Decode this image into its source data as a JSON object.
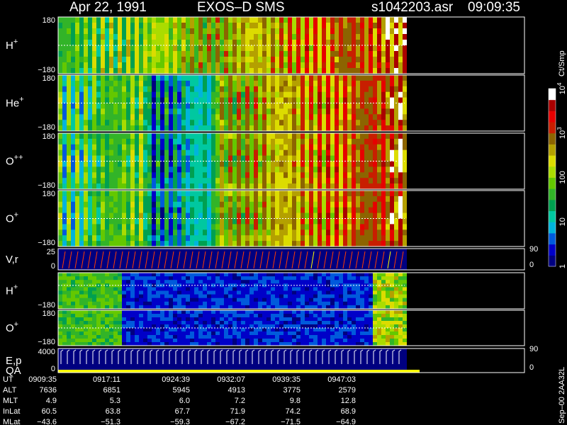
{
  "header": {
    "date": "Apr 22, 1991",
    "mission": "EXOS–D SMS",
    "file": "s1042203.asr",
    "time": "09:09:35"
  },
  "chart_data": {
    "type": "heatmap",
    "panels": [
      {
        "label": "H",
        "sup": "+",
        "ytop": "180",
        "ybot": "−180"
      },
      {
        "label": "He",
        "sup": "+",
        "ytop": "180",
        "ybot": "−180"
      },
      {
        "label": "O",
        "sup": "++",
        "ytop": "180",
        "ybot": "−180"
      },
      {
        "label": "O",
        "sup": "+",
        "ytop": "180",
        "ybot": "−180"
      },
      {
        "label": "V,r",
        "sup": "",
        "ytop": "25",
        "ybot": "0",
        "rtop": "90",
        "rbot": "0"
      },
      {
        "label": "H",
        "sup": "+",
        "ytop": "",
        "ybot": "−180"
      },
      {
        "label": "O",
        "sup": "+",
        "ytop": "180",
        "ybot": "−180"
      },
      {
        "label": "E,p",
        "sup": "",
        "label2": "QA",
        "ytop": "4000",
        "ybot": "0",
        "rtop": "90",
        "rbot": "0"
      }
    ],
    "colorbar": {
      "unit": "Ct/Smp",
      "labels": [
        {
          "base": "10",
          "exp": "4",
          "level": 1.0
        },
        {
          "base": "10",
          "exp": "3",
          "level": 0.75
        },
        {
          "base": "100",
          "exp": "",
          "level": 0.5
        },
        {
          "base": "10",
          "exp": "",
          "level": 0.25
        },
        {
          "base": "1",
          "exp": "",
          "level": 0.0
        }
      ]
    },
    "time_axis": {
      "rows": [
        "UT",
        "ALT",
        "MLT",
        "InLat",
        "MLat"
      ],
      "columns": [
        [
          "0909:35",
          "7636",
          "4.9",
          "60.5",
          "−43.6"
        ],
        [
          "0917:11",
          "6851",
          "5.3",
          "63.8",
          "−51.3"
        ],
        [
          "0924:39",
          "5945",
          "6.0",
          "67.7",
          "−59.3"
        ],
        [
          "0932:07",
          "4913",
          "7.2",
          "71.9",
          "−67.2"
        ],
        [
          "0939:35",
          "3775",
          "9.8",
          "74.2",
          "−71.5"
        ],
        [
          "0947:03",
          "2579",
          "12.8",
          "68.9",
          "−64.9"
        ]
      ]
    },
    "footer_code": "Sep–00 2AA32L"
  },
  "colors": {
    "scale": [
      "#000080",
      "#0000c8",
      "#005adc",
      "#00b4dc",
      "#00c8a0",
      "#00a050",
      "#32b428",
      "#64c800",
      "#aadc00",
      "#dcdc00",
      "#b4a000",
      "#8c6400",
      "#c81e00",
      "#e60000",
      "#aa0000",
      "#ffffff"
    ]
  }
}
